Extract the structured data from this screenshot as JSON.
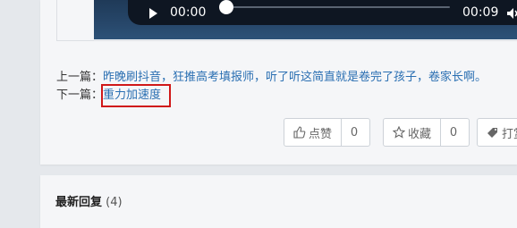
{
  "player": {
    "current_time": "00:00",
    "total_time": "00:09",
    "progress": 0.0
  },
  "post_nav": {
    "prev_label": "上一篇：",
    "prev_title": "昨晚刷抖音，狂推高考填报师，听了听这简直就是卷完了孩子，卷家长啊。",
    "next_label": "下一篇：",
    "next_title": "重力加速度"
  },
  "actions": {
    "like_label": "点赞",
    "like_count": "0",
    "favorite_label": "收藏",
    "favorite_count": "0",
    "tip_label": "打赏"
  },
  "replies": {
    "title": "最新回复",
    "count": "(4)"
  },
  "colors": {
    "link": "#2a6fb2",
    "highlight": "#d01818",
    "player_bg": "#0e1622"
  },
  "icons": {
    "play": "play-icon",
    "volume": "volume-icon",
    "like": "thumbs-up-icon",
    "favorite": "star-icon",
    "tip": "tag-icon"
  }
}
